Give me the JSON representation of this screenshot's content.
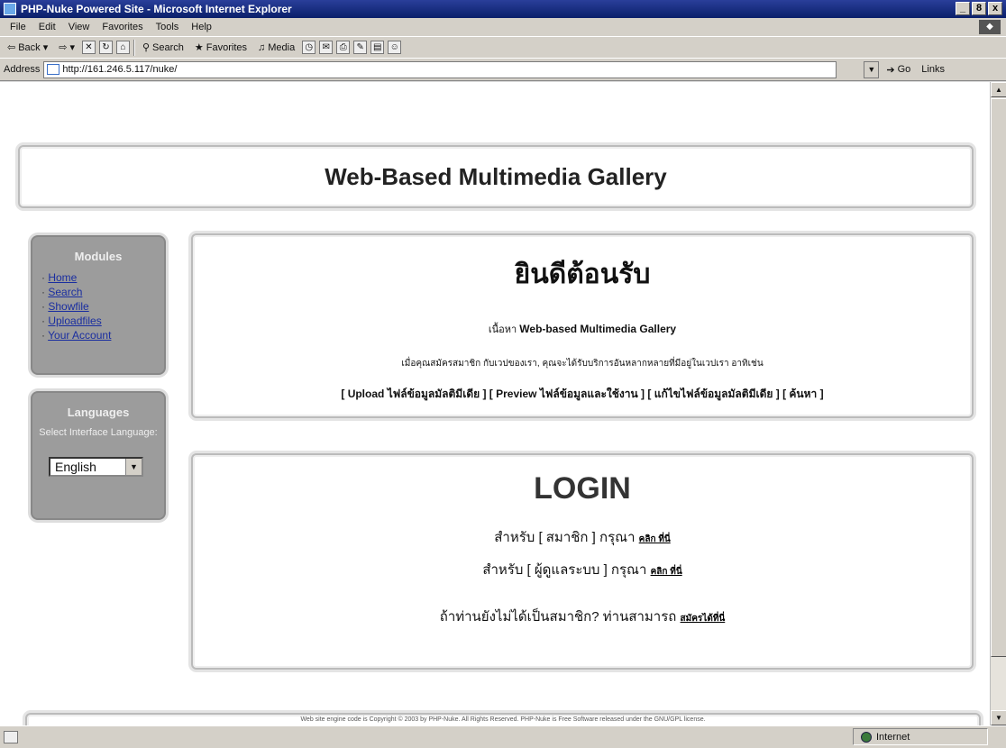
{
  "window": {
    "title": "PHP-Nuke Powered Site - Microsoft Internet Explorer",
    "controls": [
      "_",
      "8",
      "x"
    ]
  },
  "menu": [
    "File",
    "Edit",
    "View",
    "Favorites",
    "Tools",
    "Help"
  ],
  "toolbar": {
    "back": "Back",
    "search": "Search",
    "favorites": "Favorites",
    "media": "Media"
  },
  "address": {
    "label": "Address",
    "url": "http://161.246.5.117/nuke/",
    "go": "Go",
    "links": "Links"
  },
  "site": {
    "title": "Web-Based Multimedia Gallery"
  },
  "modules": {
    "title": "Modules",
    "items": [
      "Home",
      "Search",
      "Showfile",
      "Uploadfiles",
      "Your Account"
    ]
  },
  "languages": {
    "title": "Languages",
    "text": "Select Interface Language:",
    "selected": "English"
  },
  "welcome": {
    "title": "ยินดีต้อนรับ",
    "line1_prefix": "เนื้อหา",
    "line1_strong": "Web-based Multimedia Gallery",
    "line2": "เมื่อคุณสมัครสมาชิก กับเวปของเรา, คุณจะได้รับบริการอันหลากหลายที่มีอยู่ในเวปเรา อาทิเช่น",
    "links": "[ Upload ไฟล์ข้อมูลมัลติมีเดีย ] [ Preview ไฟล์ข้อมูลและใช้งาน ] [ แก้ไขไฟล์ข้อมูลมัลติมีเดีย ] [ ค้นหา ]"
  },
  "login": {
    "title": "LOGIN",
    "member_text": "สำหรับ [ สมาชิก ] กรุณา",
    "member_link": "คลิก ที่นี่",
    "admin_text": "สำหรับ [ ผู้ดูแลระบบ ] กรุณา",
    "admin_link": "คลิก ที่นี่",
    "register_text": "ถ้าท่านยังไม่ได้เป็นสมาชิก? ท่านสามารถ",
    "register_link": "สมัครได้ที่นี่"
  },
  "footer": {
    "text": "Web site engine code is Copyright © 2003 by PHP-Nuke. All Rights Reserved. PHP-Nuke is Free Software released under the GNU/GPL license."
  },
  "status": {
    "zone": "Internet"
  }
}
